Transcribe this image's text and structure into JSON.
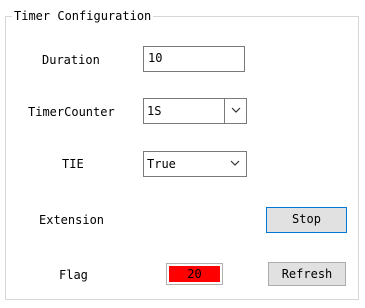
{
  "group": {
    "title": "Timer Configuration"
  },
  "duration": {
    "label": "Duration",
    "value": "10"
  },
  "timer_counter": {
    "label": "TimerCounter",
    "value": "1S"
  },
  "tie": {
    "label": "TIE",
    "value": "True"
  },
  "extension": {
    "label": "Extension",
    "button_label": "Stop"
  },
  "flag": {
    "label": "Flag",
    "value": "20",
    "color": "#ff0000",
    "refresh_label": "Refresh"
  },
  "icons": {
    "dropdown": "chevron-down-icon"
  }
}
